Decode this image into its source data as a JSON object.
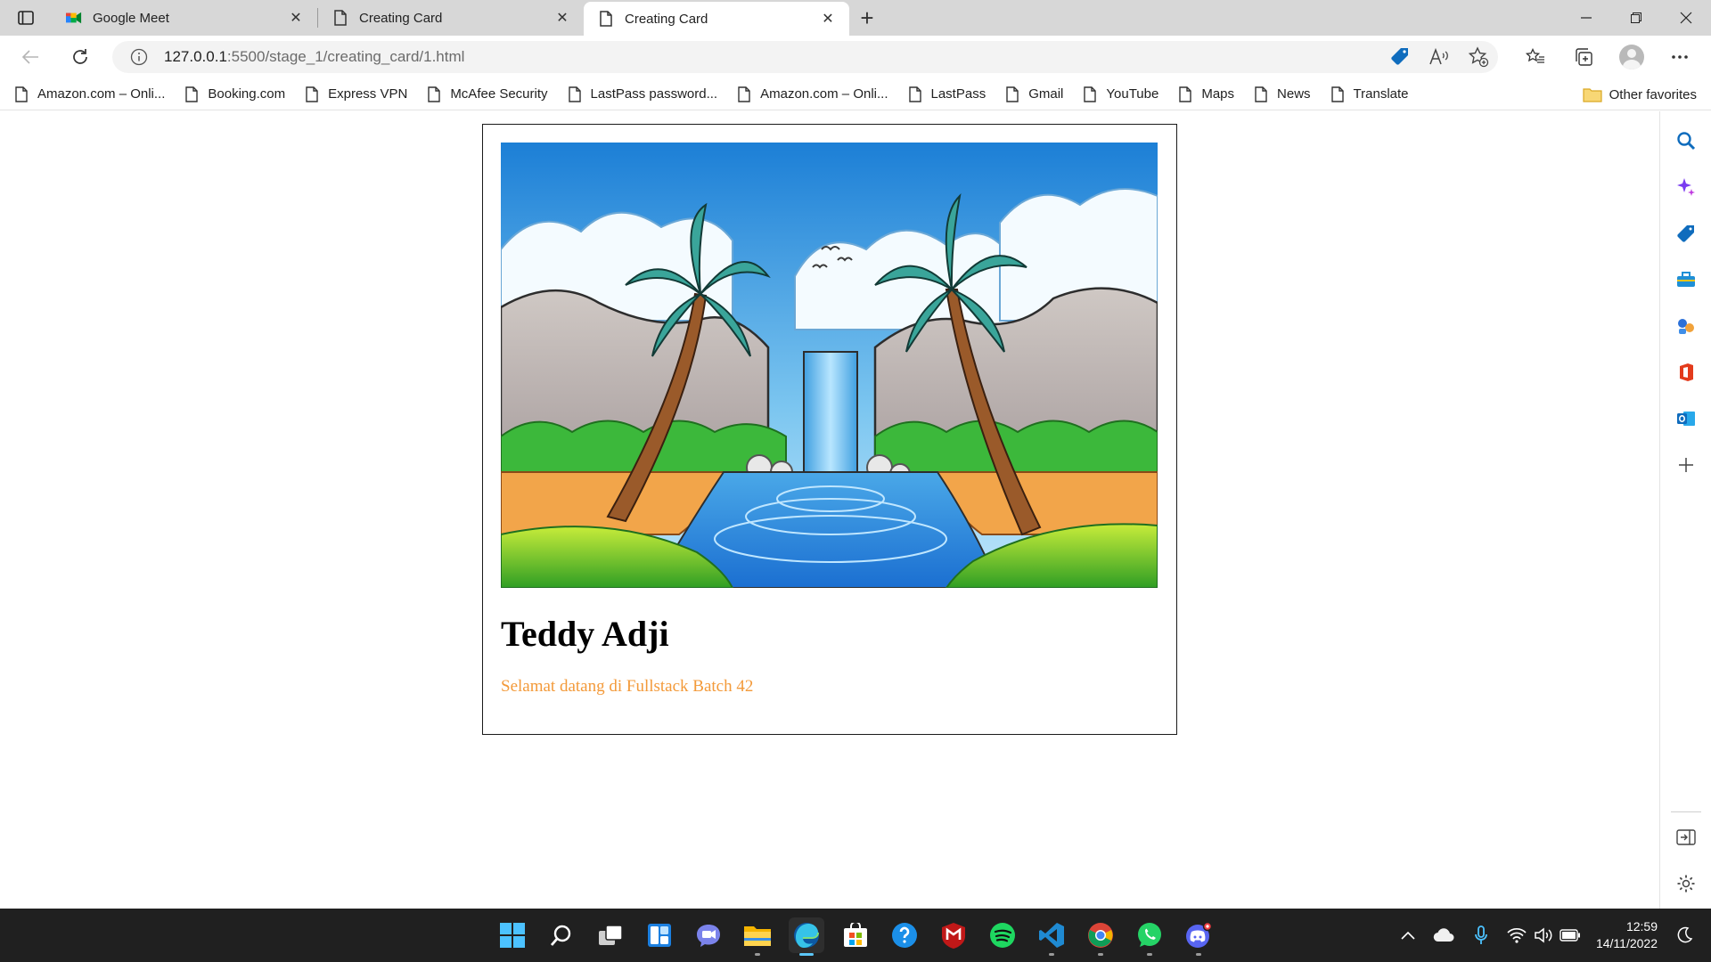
{
  "browser": {
    "tabs": [
      {
        "title": "Google Meet",
        "icon": "google-meet-icon",
        "active": false
      },
      {
        "title": "Creating Card",
        "icon": "page-icon",
        "active": false
      },
      {
        "title": "Creating Card",
        "icon": "page-icon",
        "active": true
      }
    ],
    "close_glyph": "✕",
    "new_tab_glyph": "+",
    "url_host": "127.0.0.1",
    "url_path": ":5500/stage_1/creating_card/1.html",
    "favorites": [
      "Amazon.com – Onli...",
      "Booking.com",
      "Express VPN",
      "McAfee Security",
      "LastPass password...",
      "Amazon.com – Onli...",
      "LastPass",
      "Gmail",
      "YouTube",
      "Maps",
      "News",
      "Translate"
    ],
    "other_favorites": "Other favorites"
  },
  "page": {
    "card_title": "Teddy Adji",
    "card_text": "Selamat datang di Fullstack Batch 42",
    "card_image": "waterfall-drawing"
  },
  "taskbar": {
    "apps": [
      "windows-start",
      "search",
      "task-view",
      "widgets",
      "chat",
      "file-explorer",
      "edge",
      "microsoft-store",
      "help",
      "mcafee",
      "spotify",
      "vscode",
      "chrome",
      "whatsapp",
      "discord"
    ],
    "time": "12:59",
    "date": "14/11/2022"
  },
  "colors": {
    "card_text": "#f39a3a",
    "taskbar": "#202020",
    "tab_strip": "#d7d7d7",
    "edge_accent": "#0f6cbd"
  }
}
